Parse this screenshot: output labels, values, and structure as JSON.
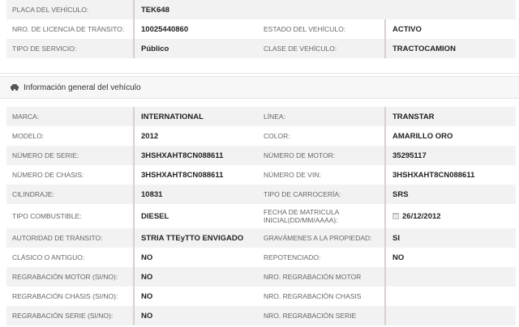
{
  "registration": {
    "placa_label": "PLACA DEL VEHÍCULO:",
    "placa_value": "TEK648",
    "licencia_label": "NRO. DE LICENCIA DE TRÁNSITO:",
    "licencia_value": "10025440860",
    "estado_label": "ESTADO DEL VEHÍCULO:",
    "estado_value": "ACTIVO",
    "servicio_label": "TIPO DE SERVICIO:",
    "servicio_value": "Público",
    "clase_label": "CLASE DE VEHÍCULO:",
    "clase_value": "TRACTOCAMION"
  },
  "section": {
    "icon": "car-icon",
    "title": "Información general del vehículo"
  },
  "general": {
    "marca_label": "MARCA:",
    "marca_value": "INTERNATIONAL",
    "linea_label": "LÍNEA:",
    "linea_value": "TRANSTAR",
    "modelo_label": "MODELO:",
    "modelo_value": "2012",
    "color_label": "COLOR:",
    "color_value": "AMARILLO ORO",
    "serie_label": "NÚMERO DE SERIE:",
    "serie_value": "3HSHXAHT8CN088611",
    "motor_label": "NÚMERO DE MOTOR:",
    "motor_value": "35295117",
    "chasis_label": "NÚMERO DE CHASIS:",
    "chasis_value": "3HSHXAHT8CN088611",
    "vin_label": "NÚMERO DE VIN:",
    "vin_value": "3HSHXAHT8CN088611",
    "cilindraje_label": "CILINDRAJE:",
    "cilindraje_value": "10831",
    "carroceria_label": "TIPO DE CARROCERÍA:",
    "carroceria_value": "SRS",
    "combustible_label": "TIPO COMBUSTIBLE:",
    "combustible_value": "DIESEL",
    "fecha_label_1": "FECHA DE MATRICULA",
    "fecha_label_2": "INICIAL(DD/MM/AAAA):",
    "fecha_value": "26/12/2012",
    "autoridad_label": "AUTORIDAD DE TRÁNSITO:",
    "autoridad_value": "STRIA TTEyTTO ENVIGADO",
    "gravamenes_label": "GRAVÁMENES A LA PROPIEDAD:",
    "gravamenes_value": "SI",
    "clasico_label": "CLÁSICO O ANTIGUO:",
    "clasico_value": "NO",
    "repotenciado_label": "REPOTENCIADO:",
    "repotenciado_value": "NO",
    "reg_motor_label": "REGRABACIÓN MOTOR (SI/NO):",
    "reg_motor_value": "NO",
    "nro_reg_motor_label": "NRO. REGRABACIÓN MOTOR",
    "nro_reg_motor_value": "",
    "reg_chasis_label": "REGRABACIÓN CHASIS (SI/NO):",
    "reg_chasis_value": "NO",
    "nro_reg_chasis_label": "NRO. REGRABACIÓN CHASIS",
    "nro_reg_chasis_value": "",
    "reg_serie_label": "REGRABACIÓN SERIE (SI/NO):",
    "reg_serie_value": "NO",
    "nro_reg_serie_label": "NRO. REGRABACIÓN SERIE",
    "nro_reg_serie_value": ""
  }
}
